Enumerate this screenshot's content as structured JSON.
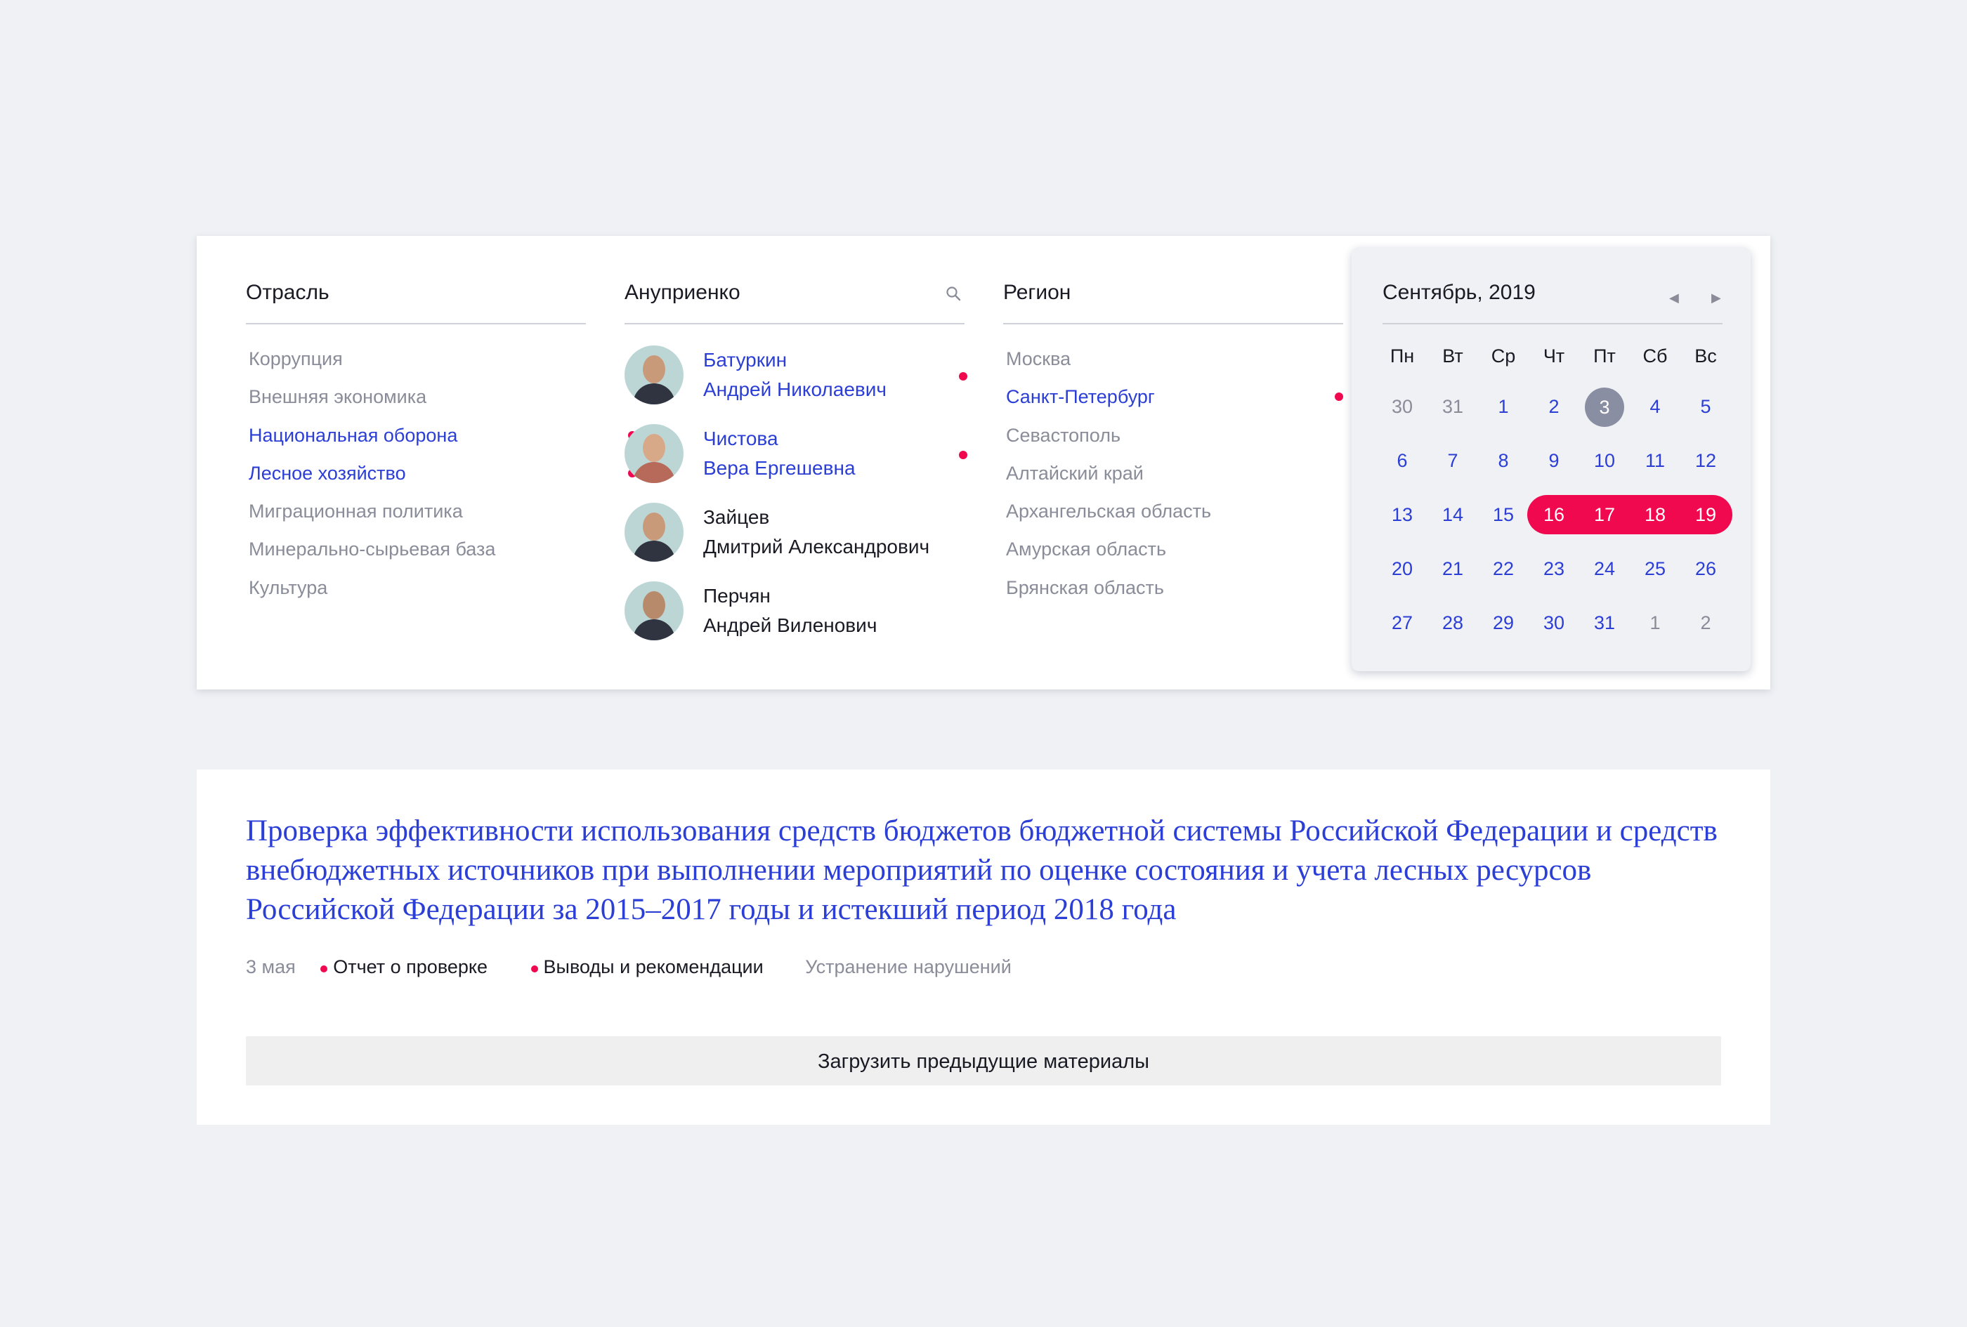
{
  "filters": {
    "industry": {
      "title": "Отрасль",
      "items": [
        {
          "label": "Коррупция",
          "selected": false
        },
        {
          "label": "Внешняя экономика",
          "selected": false
        },
        {
          "label": "Национальная оборона",
          "selected": true
        },
        {
          "label": "Лесное хозяйство",
          "selected": true
        },
        {
          "label": "Миграционная политика",
          "selected": false
        },
        {
          "label": "Минерально-сырьевая база",
          "selected": false
        },
        {
          "label": "Культура",
          "selected": false
        }
      ]
    },
    "people": {
      "search_value": "Ануприенко",
      "search_icon": "search-icon",
      "items": [
        {
          "surname": "Батуркин",
          "name": "Андрей Николаевич",
          "selected": true
        },
        {
          "surname": "Чистова",
          "name": "Вера Ергешевна",
          "selected": true
        },
        {
          "surname": "Зайцев",
          "name": "Дмитрий Александрович",
          "selected": false
        },
        {
          "surname": "Перчян",
          "name": "Андрей Виленович",
          "selected": false
        }
      ]
    },
    "region": {
      "title": "Регион",
      "items": [
        {
          "label": "Москва",
          "selected": false
        },
        {
          "label": "Санкт-Петербург",
          "selected": true
        },
        {
          "label": "Севастополь",
          "selected": false
        },
        {
          "label": "Алтайский край",
          "selected": false
        },
        {
          "label": "Архангельская область",
          "selected": false
        },
        {
          "label": "Амурская область",
          "selected": false
        },
        {
          "label": "Брянская область",
          "selected": false
        }
      ]
    },
    "calendar": {
      "month_label": "Сентябрь, 2019",
      "prev_icon": "◀",
      "next_icon": "▶",
      "weekdays": [
        "Пн",
        "Вт",
        "Ср",
        "Чт",
        "Пт",
        "Сб",
        "Вс"
      ],
      "weeks": [
        [
          "30",
          "31",
          "1",
          "2",
          "3",
          "4",
          "5"
        ],
        [
          "6",
          "7",
          "8",
          "9",
          "10",
          "11",
          "12"
        ],
        [
          "13",
          "14",
          "15",
          "16",
          "17",
          "18",
          "19"
        ],
        [
          "20",
          "21",
          "22",
          "23",
          "24",
          "25",
          "26"
        ],
        [
          "27",
          "28",
          "29",
          "30",
          "31",
          "1",
          "2"
        ]
      ],
      "today": "3",
      "selected_range": [
        "16",
        "19"
      ]
    }
  },
  "article": {
    "title": "Проверка эффективности использования средств бюджетов бюджетной системы Российской Федерации и средств внебюджетных источников при выполнении мероприятий по оценке состояния и учета лесных ресурсов Российской Федерации за 2015–2017 годы и истекший период 2018 года",
    "date": "3 мая",
    "docs": [
      {
        "label": "Отчет о проверке",
        "available": true
      },
      {
        "label": "Выводы и рекомендации",
        "available": true
      },
      {
        "label": "Устранение нарушений",
        "available": false
      }
    ]
  },
  "load_more_label": "Загрузить предыдущие материалы",
  "colors": {
    "accent": "#f0094f",
    "link": "#2b3ed6",
    "muted": "#8a8d99",
    "background": "#f0f1f5"
  }
}
